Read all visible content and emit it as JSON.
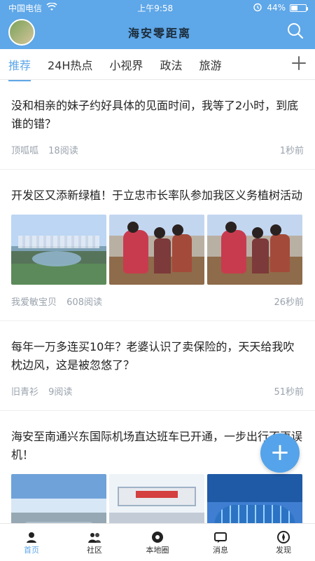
{
  "status": {
    "carrier": "中国电信",
    "time": "上午9:58",
    "battery": "44%",
    "battery_level": 0.44
  },
  "header": {
    "title": "海安零距离"
  },
  "tabs": [
    {
      "label": "推荐"
    },
    {
      "label": "24H热点"
    },
    {
      "label": "小视界"
    },
    {
      "label": "政法"
    },
    {
      "label": "旅游"
    }
  ],
  "feed": [
    {
      "title": "没和相亲的妹子约好具体的见面时间，我等了2小时，到底谁的错？",
      "author": "顶呱呱",
      "reads": "18阅读",
      "time": "1秒前"
    },
    {
      "title": "开发区又添新绿植！于立忠市长率队参加我区义务植树活动",
      "author": "我爱敏宝贝",
      "reads": "608阅读",
      "time": "26秒前"
    },
    {
      "title": "每年一万多连买10年？老婆认识了卖保险的，天天给我吹枕边风，这是被忽悠了？",
      "author": "旧青衫",
      "reads": "9阅读",
      "time": "51秒前"
    },
    {
      "title": "海安至南通兴东国际机场直达班车已开通，一步出行不再误机！"
    }
  ],
  "bottom_nav": [
    {
      "label": "首页"
    },
    {
      "label": "社区"
    },
    {
      "label": "本地圈"
    },
    {
      "label": "消息"
    },
    {
      "label": "发现"
    }
  ],
  "colors": {
    "accent": "#5ea7e8",
    "header": "#5ea7e8"
  },
  "icons": [
    "wifi-icon",
    "alarm-icon",
    "search-icon",
    "plus-icon",
    "home-icon",
    "community-icon",
    "local-circle-icon",
    "message-icon",
    "discover-icon"
  ]
}
